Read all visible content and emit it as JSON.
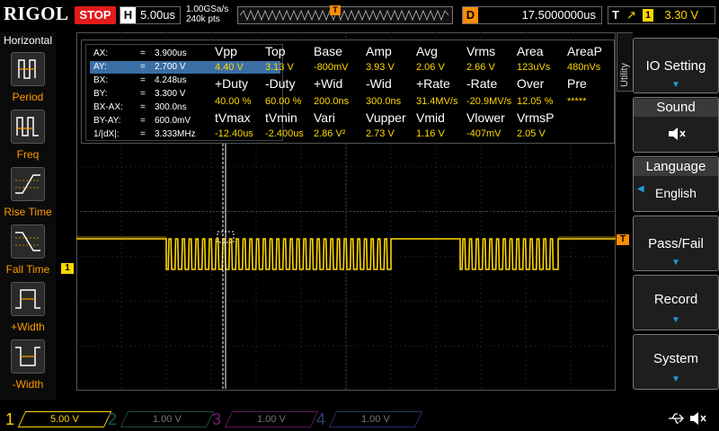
{
  "top": {
    "brand": "RIGOL",
    "run_state": "STOP",
    "h_label": "H",
    "timebase": "5.00us",
    "sample_rate": "1.00GSa/s",
    "memory_depth": "240k pts",
    "trigger_marker": "T",
    "d_label": "D",
    "delay": "17.5000000us",
    "t_label": "T",
    "trigger_edge": "↗",
    "trigger_source": "1",
    "trigger_level": "3.30 V"
  },
  "left_panel": {
    "title": "Horizontal",
    "items": [
      {
        "label": "Period",
        "icon": "period-icon"
      },
      {
        "label": "Freq",
        "icon": "freq-icon"
      },
      {
        "label": "Rise Time",
        "icon": "rise-time-icon"
      },
      {
        "label": "Fall Time",
        "icon": "fall-time-icon"
      },
      {
        "label": "+Width",
        "icon": "positive-width-icon"
      },
      {
        "label": "-Width",
        "icon": "negative-width-icon"
      }
    ]
  },
  "cursors": [
    {
      "key": "AX:",
      "eq": "=",
      "value": "3.900us"
    },
    {
      "key": "AY:",
      "eq": "=",
      "value": "2.700 V"
    },
    {
      "key": "BX:",
      "eq": "=",
      "value": "4.248us"
    },
    {
      "key": "BY:",
      "eq": "=",
      "value": "3.300 V"
    },
    {
      "key": "BX-AX:",
      "eq": "=",
      "value": "300.0ns"
    },
    {
      "key": "BY-AY:",
      "eq": "=",
      "value": "600.0mV"
    },
    {
      "key": "1/|dX|:",
      "eq": "=",
      "value": "3.333MHz"
    }
  ],
  "measurements": {
    "row1_headers": [
      "Vpp",
      "Top",
      "Base",
      "Amp",
      "Avg",
      "Vrms",
      "Area",
      "AreaP"
    ],
    "row1_values": [
      "4.40 V",
      "3.13 V",
      "-800mV",
      "3.93 V",
      "2.06 V",
      "2.66 V",
      "123uVs",
      "480nVs"
    ],
    "row2_headers": [
      "+Duty",
      "-Duty",
      "+Wid",
      "-Wid",
      "+Rate",
      "-Rate",
      "Over",
      "Pre"
    ],
    "row2_values": [
      "40.00 %",
      "60.00 %",
      "200.0ns",
      "300.0ns",
      "31.4MV/s",
      "-20.9MV/s",
      "12.05 %",
      "*****"
    ],
    "row3_headers": [
      "tVmax",
      "tVmin",
      "Vari",
      "Vupper",
      "Vmid",
      "Vlower",
      "VrmsP"
    ],
    "row3_values": [
      "-12.40us",
      "-2.400us",
      "2.86 V²",
      "2.73 V",
      "1.16 V",
      "-407mV",
      "2.05 V"
    ]
  },
  "right_panel": {
    "utility_tab": "Utility",
    "io_setting": "IO Setting",
    "sound": "Sound",
    "sound_icon": "speaker-muted-icon",
    "language_title": "Language",
    "language_value": "English",
    "pass_fail": "Pass/Fail",
    "record": "Record",
    "system": "System"
  },
  "bottom": {
    "channels": [
      {
        "num": "1",
        "scale": "5.00 V",
        "color": "#ffd700",
        "active": true
      },
      {
        "num": "2",
        "scale": "1.00 V",
        "color": "#1fb6b6",
        "active": false
      },
      {
        "num": "3",
        "scale": "1.00 V",
        "color": "#c41cc4",
        "active": false
      },
      {
        "num": "4",
        "scale": "1.00 V",
        "color": "#2b5fd8",
        "active": false
      }
    ]
  },
  "colors": {
    "ch1": "#ffd700",
    "trigger": "#ff8c00",
    "accent": "#1f9bd8"
  }
}
